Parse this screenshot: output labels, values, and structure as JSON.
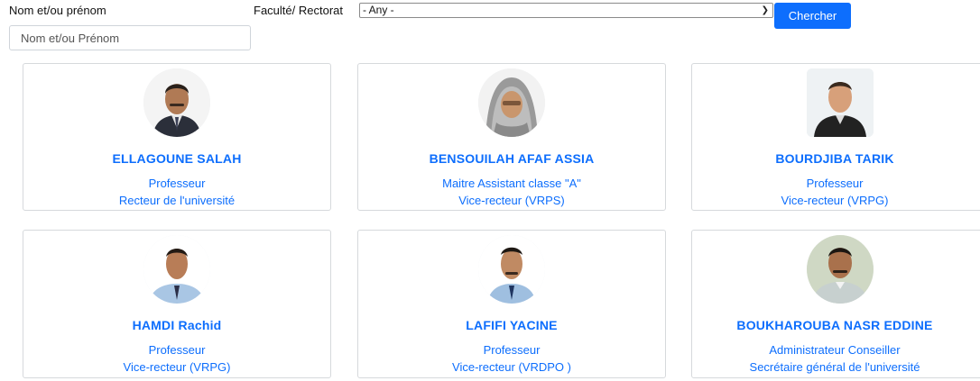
{
  "filters": {
    "name_label": "Nom et/ou prénom",
    "name_placeholder": "Nom et/ou Prénom",
    "faculty_label": "Faculté/ Rectorat",
    "faculty_selected": "- Any -",
    "search_button": "Chercher"
  },
  "people": [
    {
      "name": "ELLAGOUNE SALAH",
      "rank": "Professeur",
      "role": "Recteur de l'université",
      "photo": "portrait-photo"
    },
    {
      "name": "BENSOUILAH AFAF ASSIA",
      "rank": "Maitre Assistant classe \"A\"",
      "role": "Vice-recteur (VRPS)",
      "photo": "portrait-photo"
    },
    {
      "name": "BOURDJIBA TARIK",
      "rank": "Professeur",
      "role": "Vice-recteur (VRPG)",
      "photo": "portrait-photo"
    },
    {
      "name": "HAMDI Rachid",
      "rank": "Professeur",
      "role": "Vice-recteur (VRPG)",
      "photo": "portrait-photo"
    },
    {
      "name": "LAFIFI YACINE",
      "rank": "Professeur",
      "role": "Vice-recteur (VRDPO )",
      "photo": "portrait-photo"
    },
    {
      "name": "BOUKHAROUBA NASR EDDINE",
      "rank": "Administrateur Conseiller",
      "role": "Secrétaire général de l'université",
      "photo": "portrait-photo"
    }
  ],
  "colors": {
    "accent": "#0d6efd",
    "card_border": "#d6d9dc"
  }
}
